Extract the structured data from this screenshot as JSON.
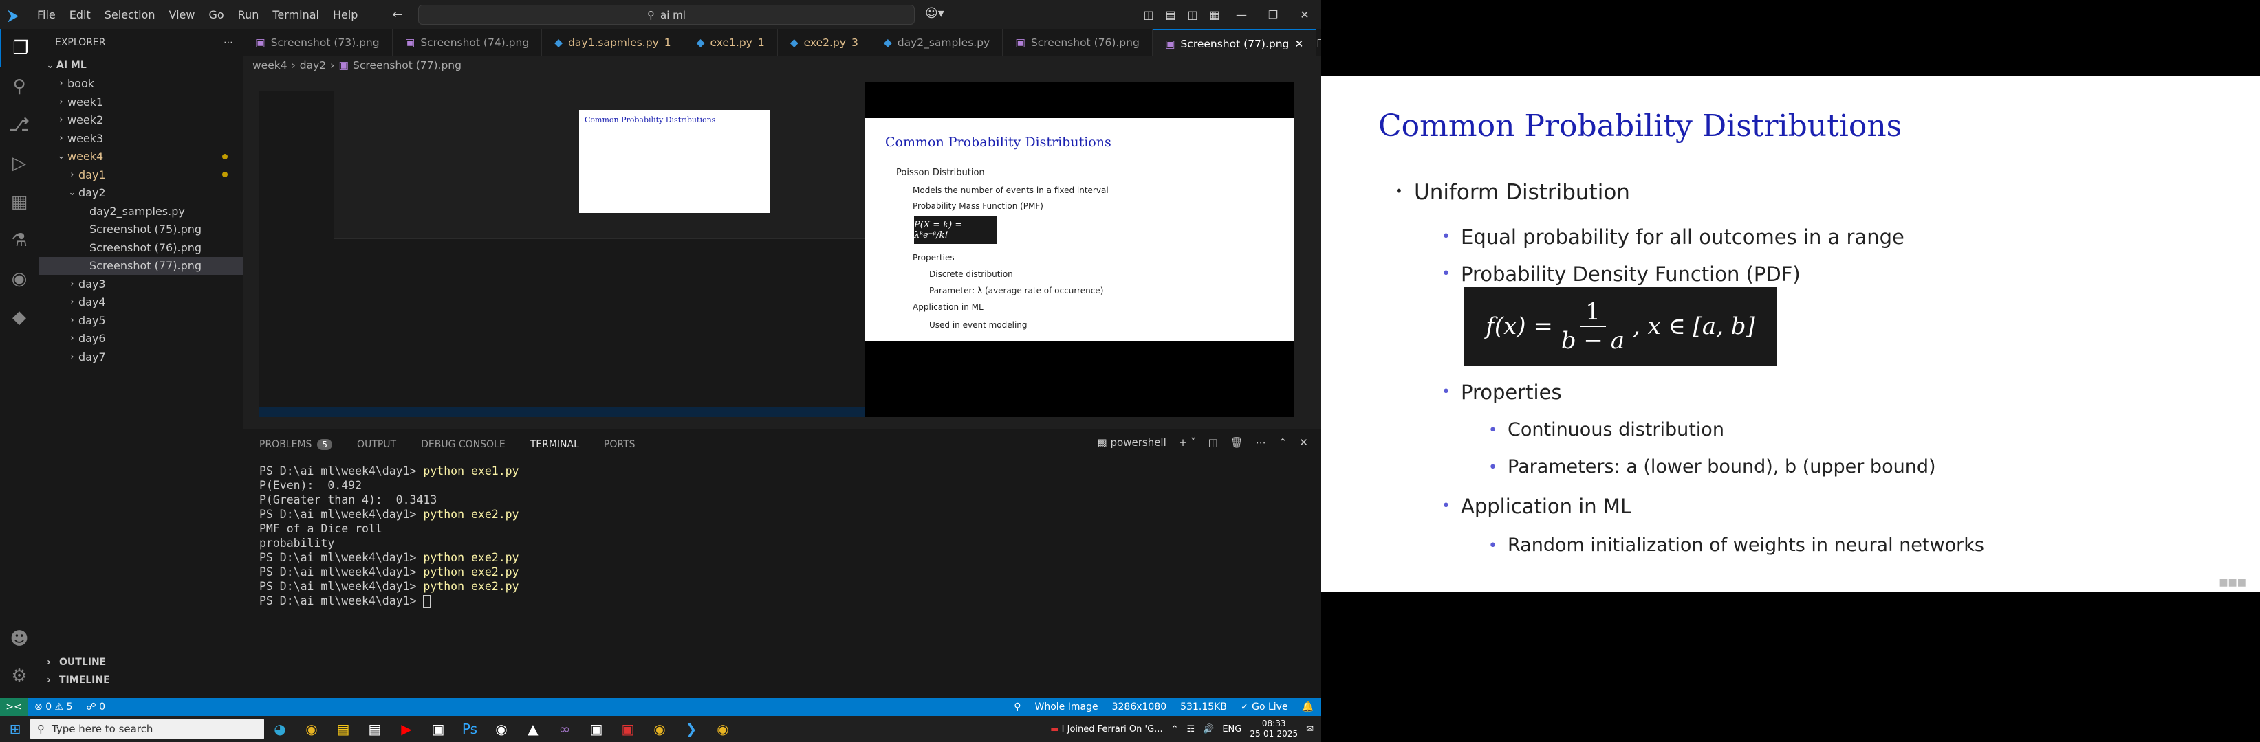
{
  "titlebar": {
    "menu": [
      "File",
      "Edit",
      "Selection",
      "View",
      "Go",
      "Run",
      "Terminal",
      "Help"
    ],
    "search_text": "ai ml"
  },
  "explorer": {
    "header": "EXPLORER",
    "root": "AI ML",
    "items": [
      {
        "label": "book",
        "type": "folder"
      },
      {
        "label": "week1",
        "type": "folder"
      },
      {
        "label": "week2",
        "type": "folder"
      },
      {
        "label": "week3",
        "type": "folder"
      },
      {
        "label": "week4",
        "type": "folder-open"
      },
      {
        "label": "day1",
        "type": "folder"
      },
      {
        "label": "day2",
        "type": "folder-open"
      },
      {
        "label": "day2_samples.py",
        "type": "file"
      },
      {
        "label": "Screenshot (75).png",
        "type": "file"
      },
      {
        "label": "Screenshot (76).png",
        "type": "file"
      },
      {
        "label": "Screenshot (77).png",
        "type": "file"
      },
      {
        "label": "day3",
        "type": "folder"
      },
      {
        "label": "day4",
        "type": "folder"
      },
      {
        "label": "day5",
        "type": "folder"
      },
      {
        "label": "day6",
        "type": "folder"
      },
      {
        "label": "day7",
        "type": "folder"
      }
    ],
    "outline": "OUTLINE",
    "timeline": "TIMELINE"
  },
  "tabs": [
    {
      "label": "Screenshot (73).png",
      "badge": ""
    },
    {
      "label": "Screenshot (74).png",
      "badge": ""
    },
    {
      "label": "day1.sapmles.py",
      "badge": "1"
    },
    {
      "label": "exe1.py",
      "badge": "1"
    },
    {
      "label": "exe2.py",
      "badge": "3"
    },
    {
      "label": "day2_samples.py",
      "badge": ""
    },
    {
      "label": "Screenshot (76).png",
      "badge": ""
    },
    {
      "label": "Screenshot (77).png",
      "badge": ""
    }
  ],
  "breadcrumb": [
    "week4",
    "day2",
    "Screenshot (77).png"
  ],
  "panel": {
    "tabs": [
      "PROBLEMS",
      "OUTPUT",
      "DEBUG CONSOLE",
      "TERMINAL",
      "PORTS"
    ],
    "problems_count": "5",
    "shell": "powershell"
  },
  "terminal_lines": [
    {
      "prompt": "PS D:\\ai ml\\week4\\day1> ",
      "cmd": "python exe1.py",
      "text": ""
    },
    {
      "prompt": "",
      "cmd": "",
      "text": "P(Even):  0.492"
    },
    {
      "prompt": "",
      "cmd": "",
      "text": "P(Greater than 4):  0.3413"
    },
    {
      "prompt": "PS D:\\ai ml\\week4\\day1> ",
      "cmd": "python exe2.py",
      "text": ""
    },
    {
      "prompt": "",
      "cmd": "",
      "text": "PMF of a Dice roll"
    },
    {
      "prompt": "",
      "cmd": "",
      "text": "probability"
    },
    {
      "prompt": "PS D:\\ai ml\\week4\\day1> ",
      "cmd": "python exe2.py",
      "text": ""
    },
    {
      "prompt": "PS D:\\ai ml\\week4\\day1> ",
      "cmd": "python exe2.py",
      "text": ""
    },
    {
      "prompt": "PS D:\\ai ml\\week4\\day1> ",
      "cmd": "python exe2.py",
      "text": ""
    },
    {
      "prompt": "PS D:\\ai ml\\week4\\day1> ",
      "cmd": "",
      "text": ""
    }
  ],
  "statusbar": {
    "errors": "0",
    "warnings": "5",
    "ports": "0",
    "image_type": "Whole Image",
    "dimensions": "3286x1080",
    "size": "531.15KB",
    "go_live": "Go Live"
  },
  "taskbar": {
    "search_placeholder": "Type here to search",
    "notification": "I Joined Ferrari On 'G...",
    "lang": "ENG",
    "time": "08:33",
    "date": "25-01-2025"
  },
  "slide": {
    "title": "Common Probability Distributions",
    "items": [
      {
        "level": 1,
        "text": "Uniform Distribution"
      },
      {
        "level": 2,
        "text": "Equal probability for all outcomes in a range"
      },
      {
        "level": 2,
        "text": "Probability Density Function (PDF)"
      },
      {
        "level": 2,
        "text": "Properties"
      },
      {
        "level": 3,
        "text": "Continuous distribution"
      },
      {
        "level": 3,
        "text": "Parameters: a (lower bound), b (upper bound)"
      },
      {
        "level": 2,
        "text": "Application in ML"
      },
      {
        "level": 3,
        "text": "Random initialization of weights in neural networks"
      }
    ],
    "formula_lhs": "f(x) =",
    "formula_num": "1",
    "formula_den": "b − a",
    "formula_rhs": ",   x ∈ [a, b]"
  },
  "nested_slide": {
    "title": "Common Probability Distributions",
    "items": [
      "Poisson Distribution",
      "Models the number of events in a fixed interval",
      "Probability Mass Function (PMF)",
      "Properties",
      "Discrete distribution",
      "Parameter: λ (average rate of occurrence)",
      "Application in ML",
      "Used in event modeling"
    ]
  }
}
